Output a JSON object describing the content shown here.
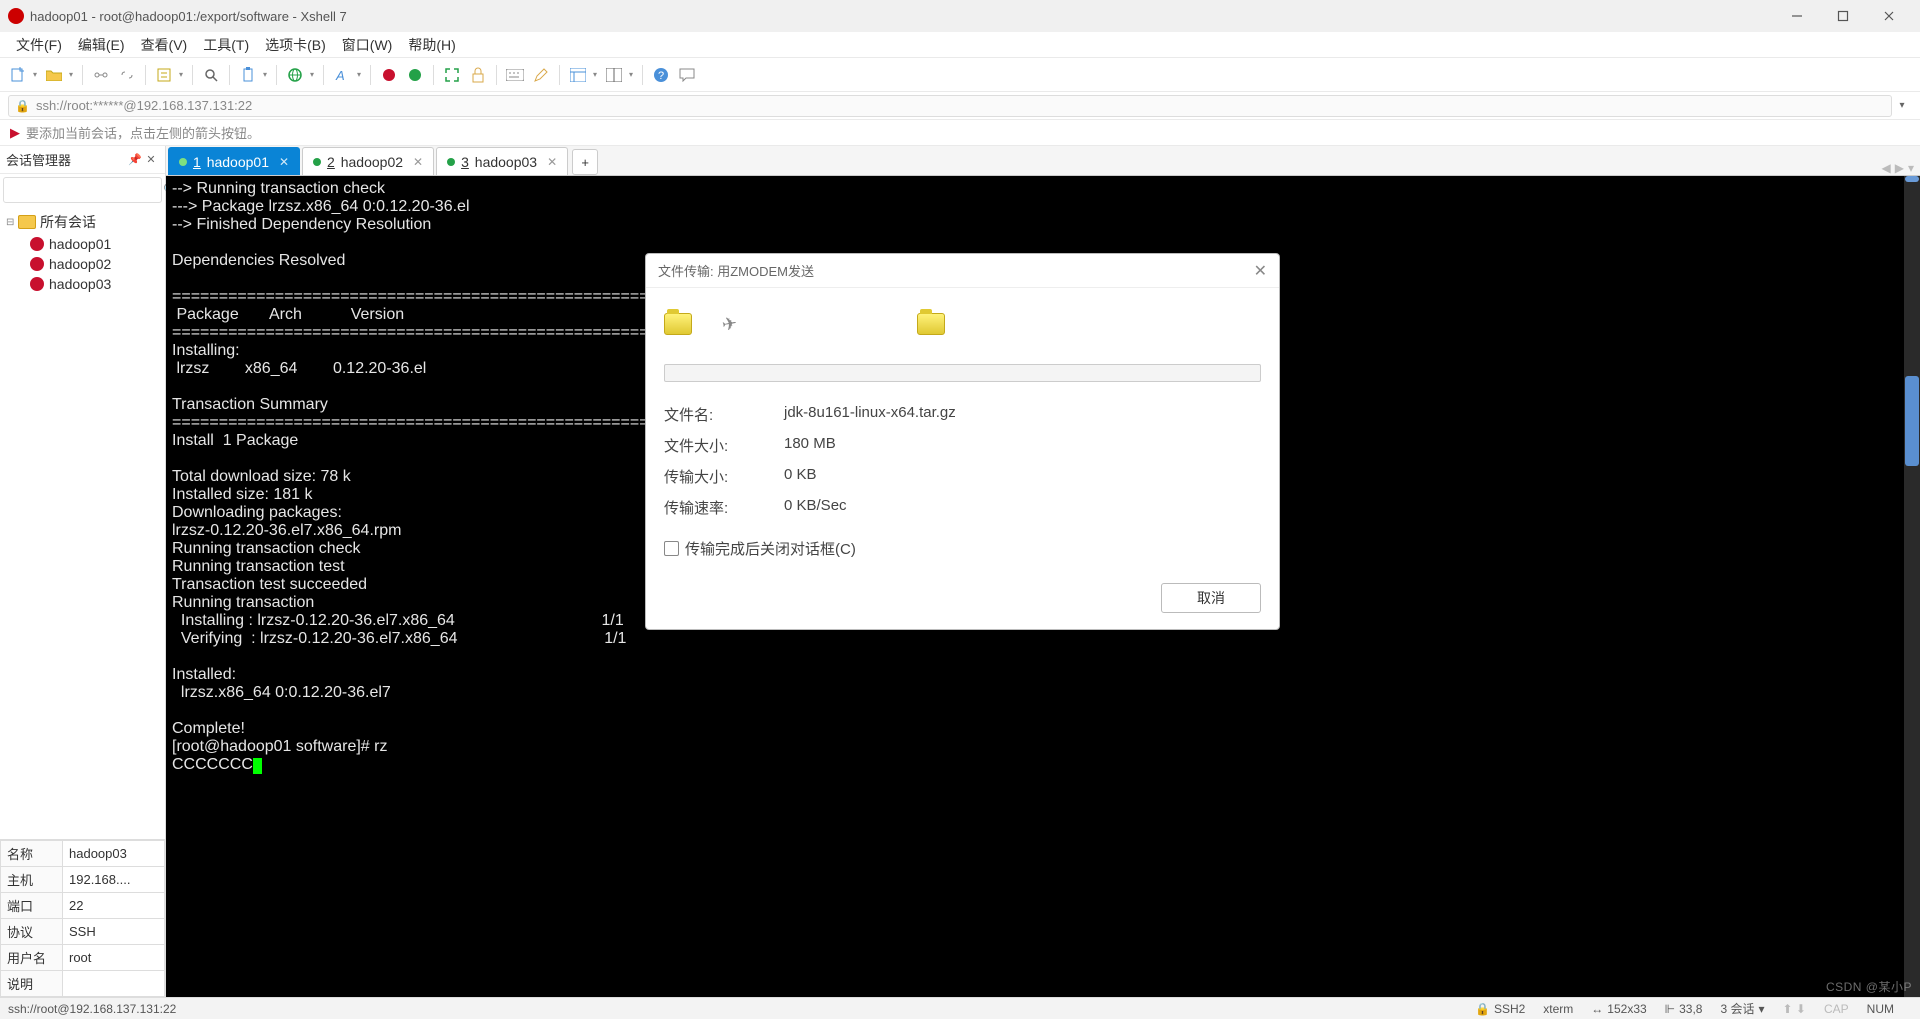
{
  "window": {
    "title": "hadoop01 - root@hadoop01:/export/software - Xshell 7"
  },
  "menus": [
    "文件(F)",
    "编辑(E)",
    "查看(V)",
    "工具(T)",
    "选项卡(B)",
    "窗口(W)",
    "帮助(H)"
  ],
  "address": {
    "url": "ssh://root:******@192.168.137.131:22"
  },
  "hint": "要添加当前会话，点击左侧的箭头按钮。",
  "sidebar": {
    "title": "会话管理器",
    "root": "所有会话",
    "items": [
      "hadoop01",
      "hadoop02",
      "hadoop03"
    ],
    "props": [
      {
        "k": "名称",
        "v": "hadoop03"
      },
      {
        "k": "主机",
        "v": "192.168...."
      },
      {
        "k": "端口",
        "v": "22"
      },
      {
        "k": "协议",
        "v": "SSH"
      },
      {
        "k": "用户名",
        "v": "root"
      },
      {
        "k": "说明",
        "v": ""
      }
    ]
  },
  "tabs": [
    {
      "num": "1",
      "label": "hadoop01",
      "active": true
    },
    {
      "num": "2",
      "label": "hadoop02",
      "active": false
    },
    {
      "num": "3",
      "label": "hadoop03",
      "active": false
    }
  ],
  "terminal": "--> Running transaction check\n---> Package lrzsz.x86_64 0:0.12.20-36.el\n--> Finished Dependency Resolution\n\nDependencies Resolved\n\n================================================================================\n Package       Arch           Version\n================================================================================\nInstalling:\n lrzsz        x86_64        0.12.20-36.el\n\nTransaction Summary\n================================================================================\nInstall  1 Package\n\nTotal download size: 78 k\nInstalled size: 181 k\nDownloading packages:\nlrzsz-0.12.20-36.el7.x86_64.rpm\nRunning transaction check\nRunning transaction test\nTransaction test succeeded\nRunning transaction\n  Installing : lrzsz-0.12.20-36.el7.x86_64                                 1/1\n  Verifying  : lrzsz-0.12.20-36.el7.x86_64                                 1/1\n\nInstalled:\n  lrzsz.x86_64 0:0.12.20-36.el7\n\nComplete!\n[root@hadoop01 software]# rz\nCCCCCCC",
  "dialog": {
    "title": "文件传输: 用ZMODEM发送",
    "labels": {
      "name": "文件名:",
      "size": "文件大小:",
      "xfer": "传输大小:",
      "rate": "传输速率:"
    },
    "values": {
      "name": "jdk-8u161-linux-x64.tar.gz",
      "size": "180 MB",
      "xfer": "0 KB",
      "rate": "0 KB/Sec"
    },
    "close_after": "传输完成后关闭对话框(C)",
    "cancel": "取消"
  },
  "status": {
    "left": "ssh://root@192.168.137.131:22",
    "ssh": "SSH2",
    "term": "xterm",
    "size": "152x33",
    "pos": "33,8",
    "sess": "3 会话",
    "cap": "CAP",
    "num": "NUM"
  },
  "watermark": "CSDN @某小P"
}
